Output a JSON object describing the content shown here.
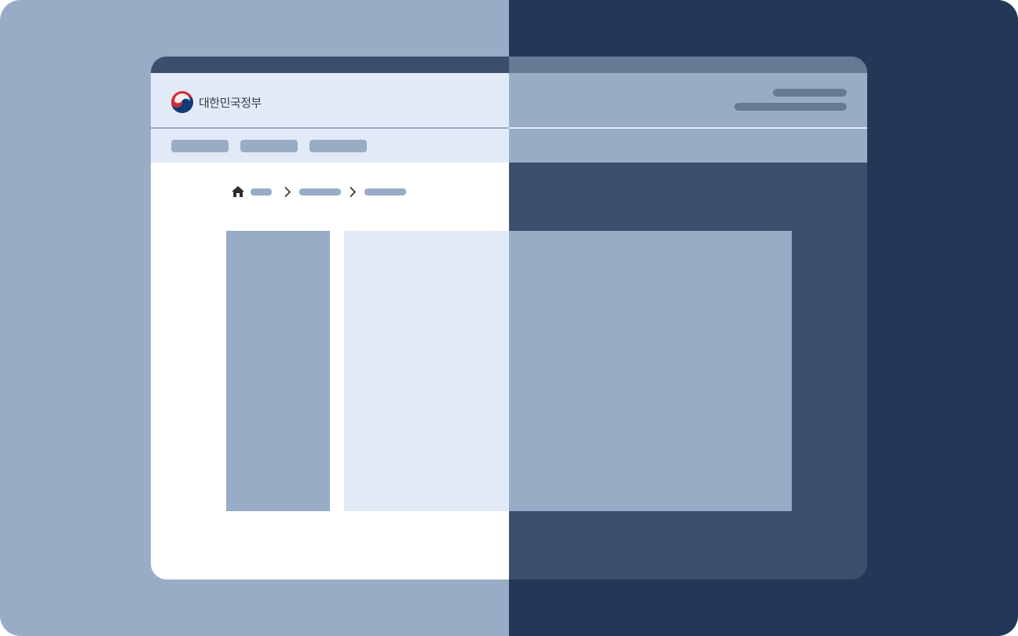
{
  "header": {
    "logo_text": "대한민국정부",
    "logo_icon": "taegeuk-emblem-icon"
  },
  "breadcrumb": {
    "home_icon": "home-icon",
    "separator_icon": "chevron-right-icon"
  },
  "colors": {
    "background_light": "#99acc6",
    "background_dark": "#233856",
    "title_bar_light": "#3a4f6c",
    "title_bar_dark": "#677a94",
    "header_light": "#e3eaf7",
    "header_dark": "#99acc6",
    "body_dark": "#3a4f6c",
    "placeholder": "#99acc6",
    "placeholder_dark": "#677a94",
    "emblem_red": "#cd2e3a",
    "emblem_blue": "#0f3b78"
  }
}
